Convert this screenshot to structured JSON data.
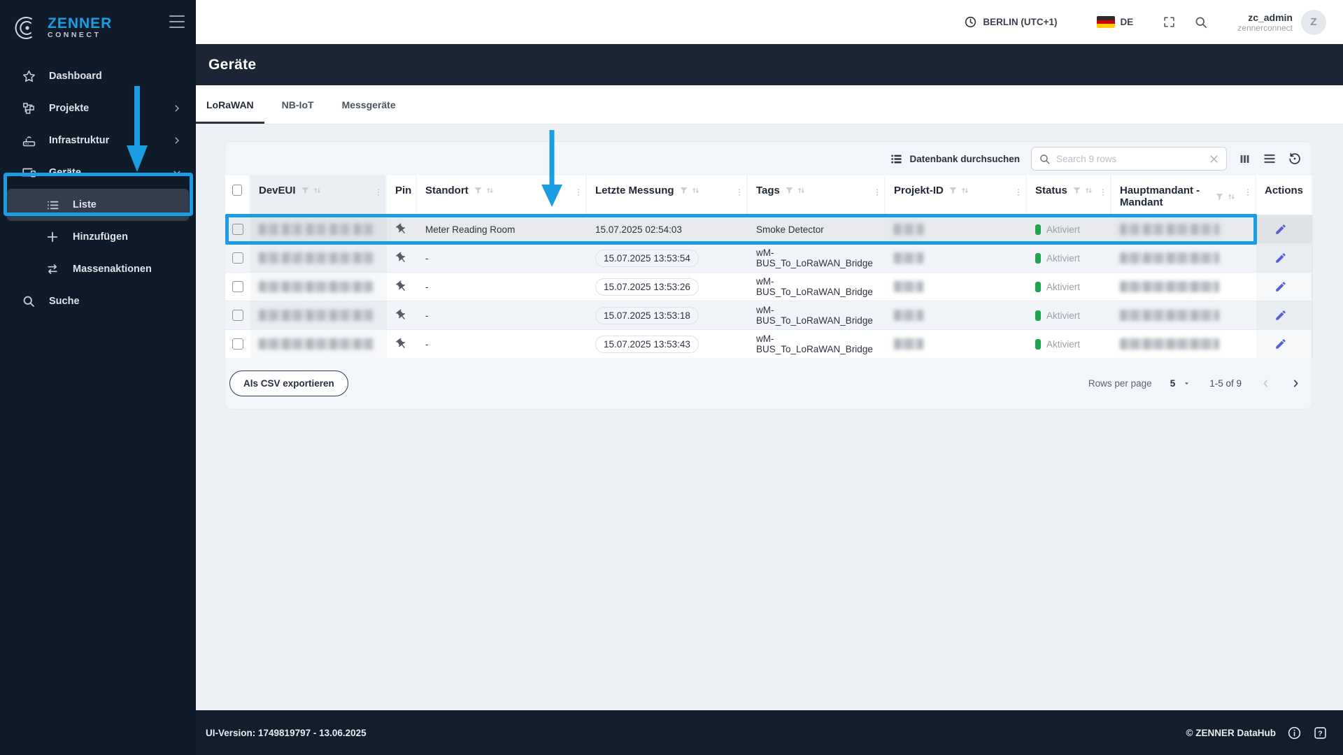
{
  "colors": {
    "accent": "#1b9de4",
    "annotation": "#1b9de4",
    "status_green": "#21a350",
    "pencil": "#5560d8",
    "sidebar_bg": "#101b2a",
    "titlebar_bg": "#1b2533",
    "footer_bg": "#131e2c",
    "page_bg": "#edf1f6"
  },
  "brand": {
    "name": "ZENNER",
    "sub": "CONNECT"
  },
  "header": {
    "timezone_label": "BERLIN (UTC+1)",
    "language": "DE",
    "username": "zc_admin",
    "account": "zennerconnect",
    "avatar_initial": "Z"
  },
  "sidebar": {
    "items": [
      {
        "id": "dashboard",
        "label": "Dashboard",
        "icon": "star"
      },
      {
        "id": "projekte",
        "label": "Projekte",
        "icon": "sitemap",
        "chevron": "right"
      },
      {
        "id": "infrastruktur",
        "label": "Infrastruktur",
        "icon": "router",
        "chevron": "right"
      },
      {
        "id": "geraete",
        "label": "Geräte",
        "icon": "devices",
        "chevron": "down"
      },
      {
        "id": "liste",
        "label": "Liste",
        "icon": "list",
        "sub": true,
        "active": true
      },
      {
        "id": "hinzufuegen",
        "label": "Hinzufügen",
        "icon": "plus",
        "sub": true
      },
      {
        "id": "massenaktionen",
        "label": "Massenaktionen",
        "icon": "swap",
        "sub": true
      },
      {
        "id": "suche",
        "label": "Suche",
        "icon": "search"
      }
    ]
  },
  "page": {
    "title": "Geräte"
  },
  "tabs": [
    {
      "label": "LoRaWAN",
      "active": true
    },
    {
      "label": "NB-IoT",
      "active": false
    },
    {
      "label": "Messgeräte",
      "active": false
    }
  ],
  "toolbar": {
    "database_search_label": "Datenbank durchsuchen",
    "search_placeholder": "Search 9 rows"
  },
  "table": {
    "columns": [
      {
        "key": "deveui",
        "label": "DevEUI",
        "sortable": true,
        "menu": true,
        "tint": true
      },
      {
        "key": "pin",
        "label": "Pin",
        "sortable": false,
        "menu": false
      },
      {
        "key": "standort",
        "label": "Standort",
        "sortable": true,
        "menu": true
      },
      {
        "key": "letzte",
        "label": "Letzte Messung",
        "sortable": true,
        "menu": true
      },
      {
        "key": "tags",
        "label": "Tags",
        "sortable": true,
        "menu": true
      },
      {
        "key": "projekt",
        "label": "Projekt-ID",
        "sortable": true,
        "menu": true
      },
      {
        "key": "status",
        "label": "Status",
        "sortable": true,
        "menu": true
      },
      {
        "key": "mandant",
        "label": "Hauptmandant - Mandant",
        "sortable": true,
        "menu": true,
        "wrap": true
      },
      {
        "key": "actions",
        "label": "Actions",
        "sortable": false,
        "menu": false
      }
    ],
    "rows": [
      {
        "standort": "Meter Reading Room",
        "letzte_messung": "15.07.2025 02:54:03",
        "letzte_pill": false,
        "tags": "Smoke Detector",
        "status": "Aktiviert",
        "highlighted": true
      },
      {
        "standort": "-",
        "letzte_messung": "15.07.2025 13:53:54",
        "letzte_pill": true,
        "tags": "wM-BUS_To_LoRaWAN_Bridge",
        "status": "Aktiviert",
        "highlighted": false
      },
      {
        "standort": "-",
        "letzte_messung": "15.07.2025 13:53:26",
        "letzte_pill": true,
        "tags": "wM-BUS_To_LoRaWAN_Bridge",
        "status": "Aktiviert",
        "highlighted": false
      },
      {
        "standort": "-",
        "letzte_messung": "15.07.2025 13:53:18",
        "letzte_pill": true,
        "tags": "wM-BUS_To_LoRaWAN_Bridge",
        "status": "Aktiviert",
        "highlighted": false
      },
      {
        "standort": "-",
        "letzte_messung": "15.07.2025 13:53:43",
        "letzte_pill": true,
        "tags": "wM-BUS_To_LoRaWAN_Bridge",
        "status": "Aktiviert",
        "highlighted": false
      }
    ]
  },
  "footer_controls": {
    "export_label": "Als CSV exportieren",
    "rows_per_page_label": "Rows per page",
    "rows_per_page_value": "5",
    "range_label": "1-5 of 9"
  },
  "app_footer": {
    "version": "UI-Version: 1749819797 - 13.06.2025",
    "copyright": "© ZENNER DataHub"
  }
}
